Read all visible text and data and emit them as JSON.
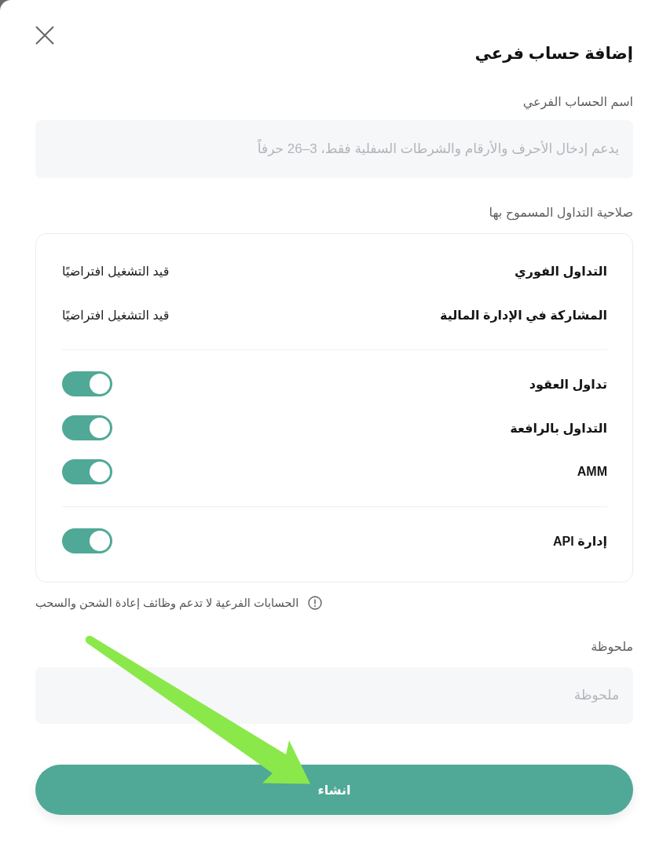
{
  "dialog": {
    "title": "إضافة حساب فرعي"
  },
  "name_field": {
    "label": "اسم الحساب الفرعي",
    "placeholder": "يدعم إدخال الأحرف والأرقام والشرطات السفلية فقط، 3–26 حرفاً"
  },
  "permissions": {
    "label": "صلاحية التداول المسموح بها",
    "groups": [
      {
        "items": [
          {
            "kind": "status",
            "name": "التداول الفوري",
            "status": "قيد التشغيل افتراضيًا"
          },
          {
            "kind": "status",
            "name": "المشاركة في الإدارة المالية",
            "status": "قيد التشغيل افتراضيًا"
          }
        ]
      },
      {
        "items": [
          {
            "kind": "toggle",
            "name": "تداول العقود",
            "on": true
          },
          {
            "kind": "toggle",
            "name": "التداول بالرافعة",
            "on": true
          },
          {
            "kind": "toggle",
            "name": "AMM",
            "on": true
          }
        ]
      },
      {
        "items": [
          {
            "kind": "toggle",
            "name": "إدارة API",
            "on": true
          }
        ]
      }
    ]
  },
  "notice": "الحسابات الفرعية لا تدعم وظائف إعادة الشحن والسحب",
  "remark_field": {
    "label": "ملحوظة",
    "placeholder": "ملحوظة"
  },
  "submit_button": "انشاء"
}
